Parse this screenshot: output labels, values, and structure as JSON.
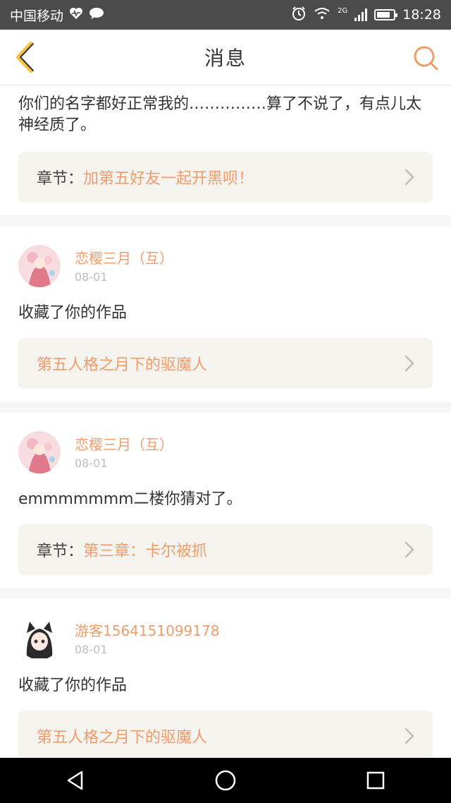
{
  "status_bar": {
    "carrier": "中国移动",
    "network_label": "2G",
    "time": "18:28"
  },
  "header": {
    "title": "消息",
    "back_icon": "back-chevron-icon",
    "search_icon": "search-icon"
  },
  "colors": {
    "accent": "#f09c6b",
    "back_icon": "#f5c341",
    "ref_bg": "#f4f3ee"
  },
  "cards": [
    {
      "message": "你们的名字都好正常我的……………算了不说了，有点儿太神经质了。",
      "ref_label": "章节：",
      "ref_title": "加第五好友一起开黑呗！"
    },
    {
      "username": "恋樱三月（互）",
      "date": "08-01",
      "message": "收藏了你的作品",
      "ref_label": "",
      "ref_title": "第五人格之月下的驱魔人"
    },
    {
      "username": "恋樱三月（互）",
      "date": "08-01",
      "message": "emmmmmmm二楼你猜对了。",
      "ref_label": "章节：",
      "ref_title": "第三章：卡尔被抓"
    },
    {
      "username": "游客1564151099178",
      "date": "08-01",
      "message": "收藏了你的作品",
      "ref_label": "",
      "ref_title": "第五人格之月下的驱魔人"
    }
  ],
  "system_nav": {
    "back": "triangle-back-icon",
    "home": "circle-home-icon",
    "recents": "square-recents-icon"
  }
}
